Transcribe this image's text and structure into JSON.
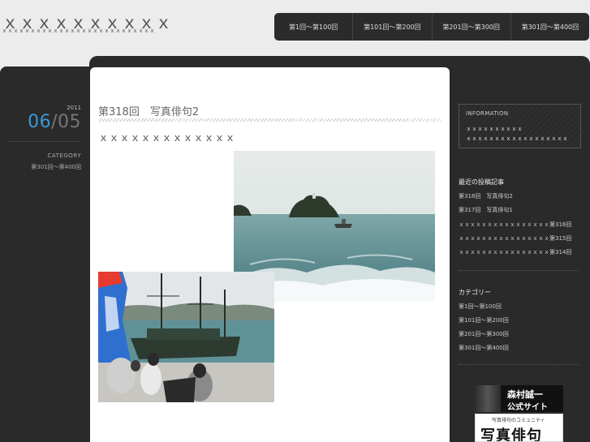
{
  "header": {
    "site_title": "ｘｘｘｘｘｘｘｘｘｘ",
    "site_description": "ｘｘｘｘｘｘｘｘｘｘｘｘｘｘｘｘｘｘｘｘｘｘｘｘｘｘｘ",
    "nav": [
      {
        "label": "第1回～第100回"
      },
      {
        "label": "第101回～第200回"
      },
      {
        "label": "第201回～第300回"
      },
      {
        "label": "第301回～第400回"
      }
    ]
  },
  "post_meta": {
    "year": "2011",
    "month": "06",
    "day": "/05",
    "category_label": "CATEGORY",
    "category_value": "第301回～第400回"
  },
  "post": {
    "title": "第318回　写真俳句2",
    "subtitle": "ｘｘｘｘｘｘｘｘｘｘｘｘｘ"
  },
  "sidebar": {
    "info_title": "INFORMATION",
    "info_lines": [
      "ｘｘｘｘｘｘｘｘｘｘ",
      "ｘｘｘｘｘｘｘｘｘｘｘｘｘｘｘｘｘｘ"
    ],
    "recent_heading": "最近の投稿記事",
    "recent_posts": [
      "第318回　写真俳句2",
      "第317回　写真俳句1",
      "ｘｘｘｘｘｘｘｘｘｘｘｘｘｘｘｘ第316回",
      "ｘｘｘｘｘｘｘｘｘｘｘｘｘｘｘｘ第315回",
      "ｘｘｘｘｘｘｘｘｘｘｘｘｘｘｘｘ第314回"
    ],
    "categories_heading": "カテゴリー",
    "categories": [
      "第1回～第100回",
      "第101回～第200回",
      "第201回～第300回",
      "第301回～第400回"
    ],
    "banner1_line1": "森村誠一",
    "banner1_line2": "公式サイト",
    "banner2_line1": "写真俳句のコミュニティ",
    "banner2_line2": "写真俳句"
  },
  "colors": {
    "accent": "#3a9ad9",
    "dark_panel": "#2a2a2a",
    "page_bg": "#ececec"
  }
}
